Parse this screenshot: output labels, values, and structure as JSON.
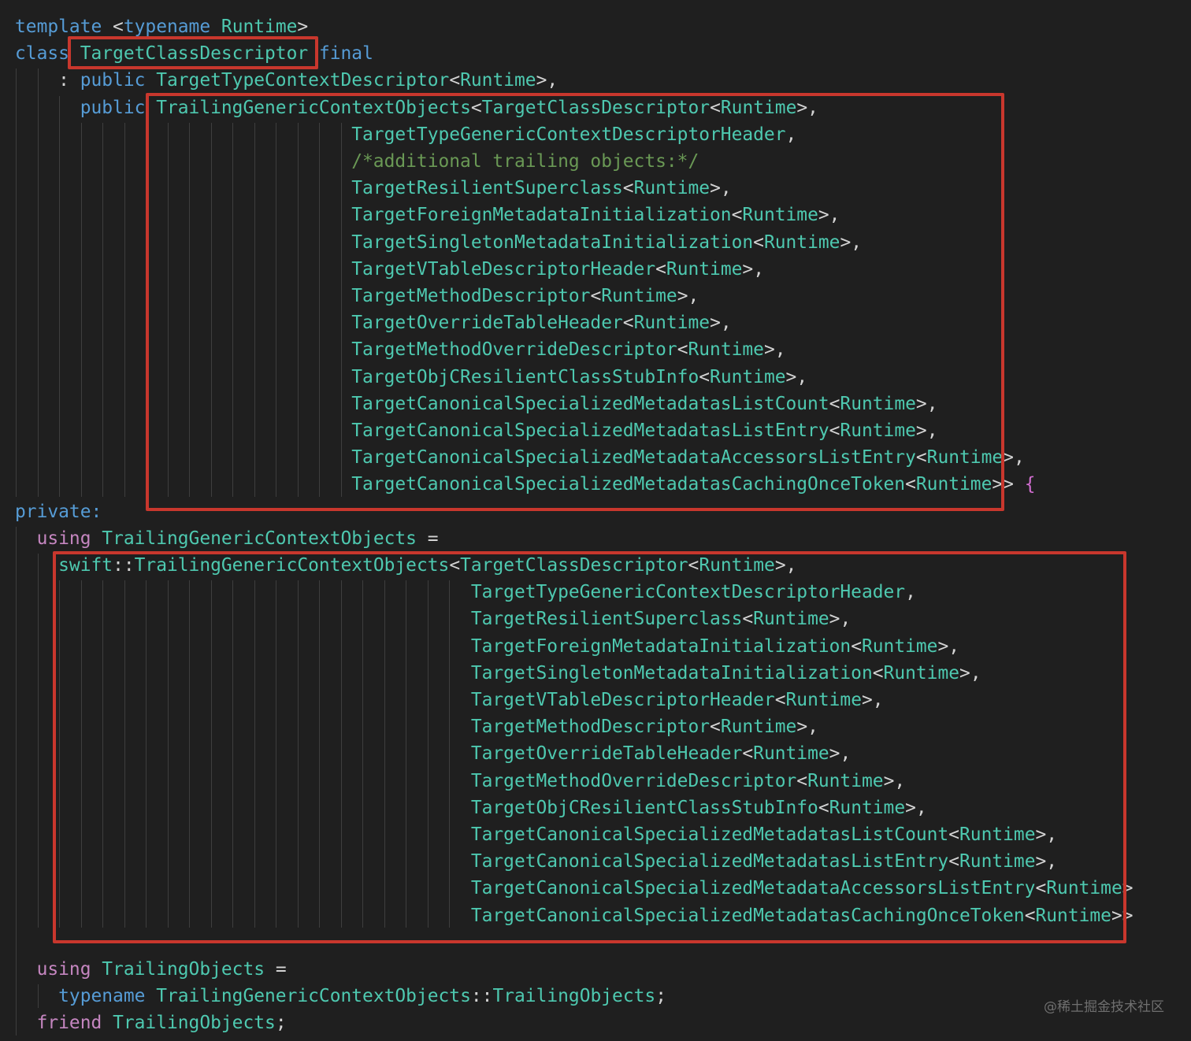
{
  "colors": {
    "background": "#1f1f1f",
    "keyword": "#569cd6",
    "control": "#c586c0",
    "type": "#4ec9b0",
    "comment": "#6a9955",
    "punctuation": "#d4d4d4",
    "brace": "#d16dd0",
    "highlight_box": "#c8372d"
  },
  "code": {
    "lines": [
      {
        "tokens": [
          {
            "t": "template",
            "k": "keyword"
          },
          {
            "t": " <",
            "k": "punctuation"
          },
          {
            "t": "typename",
            "k": "keyword"
          },
          {
            "t": " ",
            "k": "punctuation"
          },
          {
            "t": "Runtime",
            "k": "type"
          },
          {
            "t": ">",
            "k": "punctuation"
          }
        ]
      },
      {
        "tokens": [
          {
            "t": "class",
            "k": "keyword"
          },
          {
            "t": " ",
            "k": "punctuation"
          },
          {
            "t": "TargetClassDescriptor",
            "k": "type"
          },
          {
            "t": " ",
            "k": "punctuation"
          },
          {
            "t": "final",
            "k": "keyword"
          }
        ]
      },
      {
        "tokens": [
          {
            "t": "    : ",
            "k": "punctuation"
          },
          {
            "t": "public",
            "k": "keyword"
          },
          {
            "t": " ",
            "k": "punctuation"
          },
          {
            "t": "TargetTypeContextDescriptor",
            "k": "type"
          },
          {
            "t": "<",
            "k": "punctuation"
          },
          {
            "t": "Runtime",
            "k": "type"
          },
          {
            "t": ">,",
            "k": "punctuation"
          }
        ]
      },
      {
        "tokens": [
          {
            "t": "      ",
            "k": "punctuation"
          },
          {
            "t": "public",
            "k": "keyword"
          },
          {
            "t": " ",
            "k": "punctuation"
          },
          {
            "t": "TrailingGenericContextObjects",
            "k": "type"
          },
          {
            "t": "<",
            "k": "punctuation"
          },
          {
            "t": "TargetClassDescriptor",
            "k": "type"
          },
          {
            "t": "<",
            "k": "punctuation"
          },
          {
            "t": "Runtime",
            "k": "type"
          },
          {
            "t": ">,",
            "k": "punctuation"
          }
        ]
      },
      {
        "tokens": [
          {
            "t": "                               ",
            "k": "punctuation"
          },
          {
            "t": "TargetTypeGenericContextDescriptorHeader",
            "k": "type"
          },
          {
            "t": ",",
            "k": "punctuation"
          }
        ]
      },
      {
        "tokens": [
          {
            "t": "                               ",
            "k": "punctuation"
          },
          {
            "t": "/*additional trailing objects:*/",
            "k": "comment"
          }
        ]
      },
      {
        "tokens": [
          {
            "t": "                               ",
            "k": "punctuation"
          },
          {
            "t": "TargetResilientSuperclass",
            "k": "type"
          },
          {
            "t": "<",
            "k": "punctuation"
          },
          {
            "t": "Runtime",
            "k": "type"
          },
          {
            "t": ">,",
            "k": "punctuation"
          }
        ]
      },
      {
        "tokens": [
          {
            "t": "                               ",
            "k": "punctuation"
          },
          {
            "t": "TargetForeignMetadataInitialization",
            "k": "type"
          },
          {
            "t": "<",
            "k": "punctuation"
          },
          {
            "t": "Runtime",
            "k": "type"
          },
          {
            "t": ">,",
            "k": "punctuation"
          }
        ]
      },
      {
        "tokens": [
          {
            "t": "                               ",
            "k": "punctuation"
          },
          {
            "t": "TargetSingletonMetadataInitialization",
            "k": "type"
          },
          {
            "t": "<",
            "k": "punctuation"
          },
          {
            "t": "Runtime",
            "k": "type"
          },
          {
            "t": ">,",
            "k": "punctuation"
          }
        ]
      },
      {
        "tokens": [
          {
            "t": "                               ",
            "k": "punctuation"
          },
          {
            "t": "TargetVTableDescriptorHeader",
            "k": "type"
          },
          {
            "t": "<",
            "k": "punctuation"
          },
          {
            "t": "Runtime",
            "k": "type"
          },
          {
            "t": ">,",
            "k": "punctuation"
          }
        ]
      },
      {
        "tokens": [
          {
            "t": "                               ",
            "k": "punctuation"
          },
          {
            "t": "TargetMethodDescriptor",
            "k": "type"
          },
          {
            "t": "<",
            "k": "punctuation"
          },
          {
            "t": "Runtime",
            "k": "type"
          },
          {
            "t": ">,",
            "k": "punctuation"
          }
        ]
      },
      {
        "tokens": [
          {
            "t": "                               ",
            "k": "punctuation"
          },
          {
            "t": "TargetOverrideTableHeader",
            "k": "type"
          },
          {
            "t": "<",
            "k": "punctuation"
          },
          {
            "t": "Runtime",
            "k": "type"
          },
          {
            "t": ">,",
            "k": "punctuation"
          }
        ]
      },
      {
        "tokens": [
          {
            "t": "                               ",
            "k": "punctuation"
          },
          {
            "t": "TargetMethodOverrideDescriptor",
            "k": "type"
          },
          {
            "t": "<",
            "k": "punctuation"
          },
          {
            "t": "Runtime",
            "k": "type"
          },
          {
            "t": ">,",
            "k": "punctuation"
          }
        ]
      },
      {
        "tokens": [
          {
            "t": "                               ",
            "k": "punctuation"
          },
          {
            "t": "TargetObjCResilientClassStubInfo",
            "k": "type"
          },
          {
            "t": "<",
            "k": "punctuation"
          },
          {
            "t": "Runtime",
            "k": "type"
          },
          {
            "t": ">,",
            "k": "punctuation"
          }
        ]
      },
      {
        "tokens": [
          {
            "t": "                               ",
            "k": "punctuation"
          },
          {
            "t": "TargetCanonicalSpecializedMetadatasListCount",
            "k": "type"
          },
          {
            "t": "<",
            "k": "punctuation"
          },
          {
            "t": "Runtime",
            "k": "type"
          },
          {
            "t": ">,",
            "k": "punctuation"
          }
        ]
      },
      {
        "tokens": [
          {
            "t": "                               ",
            "k": "punctuation"
          },
          {
            "t": "TargetCanonicalSpecializedMetadatasListEntry",
            "k": "type"
          },
          {
            "t": "<",
            "k": "punctuation"
          },
          {
            "t": "Runtime",
            "k": "type"
          },
          {
            "t": ">,",
            "k": "punctuation"
          }
        ]
      },
      {
        "tokens": [
          {
            "t": "                               ",
            "k": "punctuation"
          },
          {
            "t": "TargetCanonicalSpecializedMetadataAccessorsListEntry",
            "k": "type"
          },
          {
            "t": "<",
            "k": "punctuation"
          },
          {
            "t": "Runtime",
            "k": "type"
          },
          {
            "t": ">,",
            "k": "punctuation"
          }
        ]
      },
      {
        "tokens": [
          {
            "t": "                               ",
            "k": "punctuation"
          },
          {
            "t": "TargetCanonicalSpecializedMetadatasCachingOnceToken",
            "k": "type"
          },
          {
            "t": "<",
            "k": "punctuation"
          },
          {
            "t": "Runtime",
            "k": "type"
          },
          {
            "t": ">> ",
            "k": "punctuation"
          },
          {
            "t": "{",
            "k": "brace"
          }
        ]
      },
      {
        "tokens": [
          {
            "t": "private:",
            "k": "keyword"
          }
        ]
      },
      {
        "tokens": [
          {
            "t": "  ",
            "k": "punctuation"
          },
          {
            "t": "using",
            "k": "control"
          },
          {
            "t": " ",
            "k": "punctuation"
          },
          {
            "t": "TrailingGenericContextObjects",
            "k": "type"
          },
          {
            "t": " =",
            "k": "punctuation"
          }
        ]
      },
      {
        "tokens": [
          {
            "t": "    ",
            "k": "punctuation"
          },
          {
            "t": "swift",
            "k": "type"
          },
          {
            "t": "::",
            "k": "punctuation"
          },
          {
            "t": "TrailingGenericContextObjects",
            "k": "type"
          },
          {
            "t": "<",
            "k": "punctuation"
          },
          {
            "t": "TargetClassDescriptor",
            "k": "type"
          },
          {
            "t": "<",
            "k": "punctuation"
          },
          {
            "t": "Runtime",
            "k": "type"
          },
          {
            "t": ">,",
            "k": "punctuation"
          }
        ]
      },
      {
        "tokens": [
          {
            "t": "                                          ",
            "k": "punctuation"
          },
          {
            "t": "TargetTypeGenericContextDescriptorHeader",
            "k": "type"
          },
          {
            "t": ",",
            "k": "punctuation"
          }
        ]
      },
      {
        "tokens": [
          {
            "t": "                                          ",
            "k": "punctuation"
          },
          {
            "t": "TargetResilientSuperclass",
            "k": "type"
          },
          {
            "t": "<",
            "k": "punctuation"
          },
          {
            "t": "Runtime",
            "k": "type"
          },
          {
            "t": ">,",
            "k": "punctuation"
          }
        ]
      },
      {
        "tokens": [
          {
            "t": "                                          ",
            "k": "punctuation"
          },
          {
            "t": "TargetForeignMetadataInitialization",
            "k": "type"
          },
          {
            "t": "<",
            "k": "punctuation"
          },
          {
            "t": "Runtime",
            "k": "type"
          },
          {
            "t": ">,",
            "k": "punctuation"
          }
        ]
      },
      {
        "tokens": [
          {
            "t": "                                          ",
            "k": "punctuation"
          },
          {
            "t": "TargetSingletonMetadataInitialization",
            "k": "type"
          },
          {
            "t": "<",
            "k": "punctuation"
          },
          {
            "t": "Runtime",
            "k": "type"
          },
          {
            "t": ">,",
            "k": "punctuation"
          }
        ]
      },
      {
        "tokens": [
          {
            "t": "                                          ",
            "k": "punctuation"
          },
          {
            "t": "TargetVTableDescriptorHeader",
            "k": "type"
          },
          {
            "t": "<",
            "k": "punctuation"
          },
          {
            "t": "Runtime",
            "k": "type"
          },
          {
            "t": ">,",
            "k": "punctuation"
          }
        ]
      },
      {
        "tokens": [
          {
            "t": "                                          ",
            "k": "punctuation"
          },
          {
            "t": "TargetMethodDescriptor",
            "k": "type"
          },
          {
            "t": "<",
            "k": "punctuation"
          },
          {
            "t": "Runtime",
            "k": "type"
          },
          {
            "t": ">,",
            "k": "punctuation"
          }
        ]
      },
      {
        "tokens": [
          {
            "t": "                                          ",
            "k": "punctuation"
          },
          {
            "t": "TargetOverrideTableHeader",
            "k": "type"
          },
          {
            "t": "<",
            "k": "punctuation"
          },
          {
            "t": "Runtime",
            "k": "type"
          },
          {
            "t": ">,",
            "k": "punctuation"
          }
        ]
      },
      {
        "tokens": [
          {
            "t": "                                          ",
            "k": "punctuation"
          },
          {
            "t": "TargetMethodOverrideDescriptor",
            "k": "type"
          },
          {
            "t": "<",
            "k": "punctuation"
          },
          {
            "t": "Runtime",
            "k": "type"
          },
          {
            "t": ">,",
            "k": "punctuation"
          }
        ]
      },
      {
        "tokens": [
          {
            "t": "                                          ",
            "k": "punctuation"
          },
          {
            "t": "TargetObjCResilientClassStubInfo",
            "k": "type"
          },
          {
            "t": "<",
            "k": "punctuation"
          },
          {
            "t": "Runtime",
            "k": "type"
          },
          {
            "t": ">,",
            "k": "punctuation"
          }
        ]
      },
      {
        "tokens": [
          {
            "t": "                                          ",
            "k": "punctuation"
          },
          {
            "t": "TargetCanonicalSpecializedMetadatasListCount",
            "k": "type"
          },
          {
            "t": "<",
            "k": "punctuation"
          },
          {
            "t": "Runtime",
            "k": "type"
          },
          {
            "t": ">,",
            "k": "punctuation"
          }
        ]
      },
      {
        "tokens": [
          {
            "t": "                                          ",
            "k": "punctuation"
          },
          {
            "t": "TargetCanonicalSpecializedMetadatasListEntry",
            "k": "type"
          },
          {
            "t": "<",
            "k": "punctuation"
          },
          {
            "t": "Runtime",
            "k": "type"
          },
          {
            "t": ">,",
            "k": "punctuation"
          }
        ]
      },
      {
        "tokens": [
          {
            "t": "                                          ",
            "k": "punctuation"
          },
          {
            "t": "TargetCanonicalSpecializedMetadataAccessorsListEntry",
            "k": "type"
          },
          {
            "t": "<",
            "k": "punctuation"
          },
          {
            "t": "Runtime",
            "k": "type"
          },
          {
            "t": ">",
            "k": "punctuation"
          }
        ]
      },
      {
        "tokens": [
          {
            "t": "                                          ",
            "k": "punctuation"
          },
          {
            "t": "TargetCanonicalSpecializedMetadatasCachingOnceToken",
            "k": "type"
          },
          {
            "t": "<",
            "k": "punctuation"
          },
          {
            "t": "Runtime",
            "k": "type"
          },
          {
            "t": ">>",
            "k": "punctuation"
          }
        ]
      },
      {
        "tokens": []
      },
      {
        "tokens": [
          {
            "t": "  ",
            "k": "punctuation"
          },
          {
            "t": "using",
            "k": "control"
          },
          {
            "t": " ",
            "k": "punctuation"
          },
          {
            "t": "TrailingObjects",
            "k": "type"
          },
          {
            "t": " =",
            "k": "punctuation"
          }
        ]
      },
      {
        "tokens": [
          {
            "t": "    ",
            "k": "punctuation"
          },
          {
            "t": "typename",
            "k": "keyword"
          },
          {
            "t": " ",
            "k": "punctuation"
          },
          {
            "t": "TrailingGenericContextObjects",
            "k": "type"
          },
          {
            "t": "::",
            "k": "punctuation"
          },
          {
            "t": "TrailingObjects",
            "k": "type"
          },
          {
            "t": ";",
            "k": "punctuation"
          }
        ]
      },
      {
        "tokens": [
          {
            "t": "  ",
            "k": "punctuation"
          },
          {
            "t": "friend",
            "k": "control"
          },
          {
            "t": " ",
            "k": "punctuation"
          },
          {
            "t": "TrailingObjects",
            "k": "type"
          },
          {
            "t": ";",
            "k": "punctuation"
          }
        ]
      }
    ]
  },
  "watermark": "@稀土掘金技术社区"
}
